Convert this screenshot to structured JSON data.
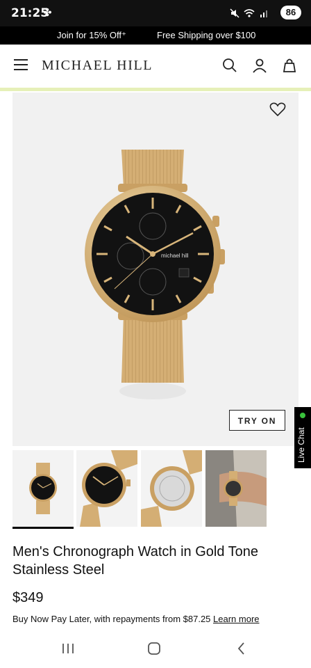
{
  "status_bar": {
    "time": "21:25",
    "battery": "86"
  },
  "promo": {
    "left": "Join for 15% Off⁺",
    "right": "Free Shipping over $100"
  },
  "header": {
    "brand": "MICHAEL HILL"
  },
  "hero": {
    "try_on_label": "TRY ON",
    "dial_brand": "michael hill"
  },
  "live_chat": {
    "label": "Live Chat"
  },
  "product": {
    "title": "Men's Chronograph Watch in Gold Tone Stainless Steel",
    "price": "$349",
    "bnpl_text": "Buy Now Pay Later, with repayments from $87.25 ",
    "bnpl_link": "Learn more"
  },
  "colors": {
    "accent_bar": "#e6f0b8",
    "gold": "#cfa86a",
    "dial": "#121212",
    "promo_bg": "#000000"
  },
  "icons": [
    "menu-icon",
    "search-icon",
    "account-icon",
    "bag-icon",
    "heart-icon",
    "recents-icon",
    "home-icon",
    "back-icon"
  ]
}
